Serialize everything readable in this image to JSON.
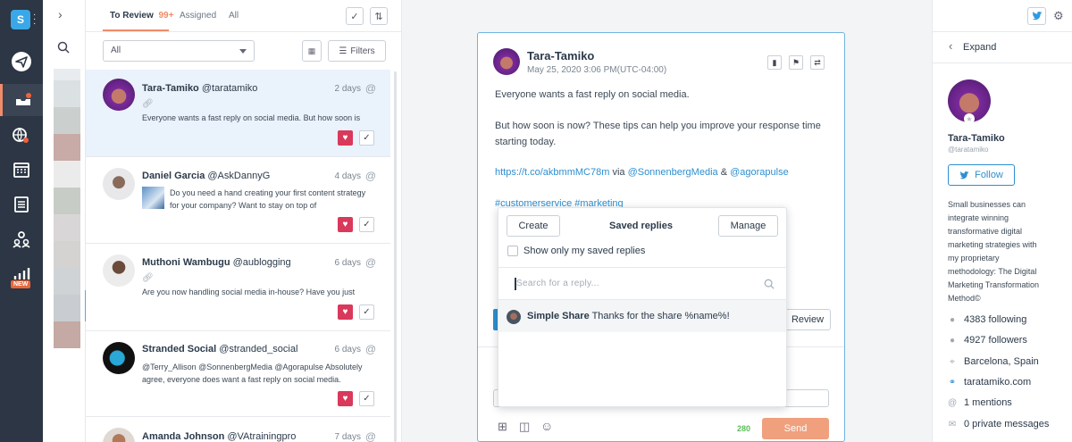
{
  "nav": {
    "brand_letter": "S",
    "items": [
      {
        "name": "publish",
        "icon": "paper-plane-icon"
      },
      {
        "name": "inbox",
        "icon": "inbox-icon",
        "active": true
      },
      {
        "name": "listening",
        "icon": "globe-search-icon"
      },
      {
        "name": "calendar",
        "icon": "calendar-icon"
      },
      {
        "name": "planner",
        "icon": "clipboard-calendar-icon"
      },
      {
        "name": "team",
        "icon": "team-icon"
      },
      {
        "name": "reports",
        "icon": "bar-chart-icon"
      }
    ],
    "new_badge": "NEW",
    "accent_color": "#f08c6a"
  },
  "list": {
    "tabs": {
      "to_review": "To Review",
      "to_review_count": "99+",
      "assigned": "Assigned",
      "all": "All"
    },
    "filter_select": "All",
    "filters_label": "Filters",
    "items": [
      {
        "name": "Tara-Tamiko",
        "handle": "@taratamiko",
        "date": "2 days",
        "body": "Everyone wants a fast reply on social media. But how soon is"
      },
      {
        "name": "Daniel Garcia",
        "handle": "@AskDannyG",
        "date": "4 days",
        "body": "Do you need a hand creating your first content strategy for your company? Want to stay on top of"
      },
      {
        "name": "Muthoni Wambugu",
        "handle": "@aublogging",
        "date": "6 days",
        "body": "Are you now handling social media in-house? Have you just"
      },
      {
        "name": "Stranded Social",
        "handle": "@stranded_social",
        "date": "6 days",
        "body": "@Terry_Allison @SonnenbergMedia @Agorapulse Absolutely agree, everyone does want a fast reply on social media."
      },
      {
        "name": "Amanda Johnson",
        "handle": "@VAtrainingpro",
        "date": "7 days",
        "body": ""
      }
    ]
  },
  "detail": {
    "name": "Tara-Tamiko",
    "date": "May 25, 2020 3:06 PM(UTC-04:00)",
    "p1": "Everyone wants a fast reply on social media.",
    "p2a": "But how soon is now? These tips can help you improve your response time",
    "p2b": "starting today.",
    "link_url": "https://t.co/akbmmMC78m",
    "via": "via",
    "mention1": "@SonnenbergMedia",
    "amp": "&",
    "mention2": "@agorapulse",
    "hashtags": "#customerservice #marketing",
    "review_label": "Review",
    "char_count": "280",
    "send_label": "Send"
  },
  "saved_replies": {
    "create_label": "Create",
    "title": "Saved replies",
    "manage_label": "Manage",
    "only_mine_label": "Show only my saved replies",
    "search_placeholder": "Search for a reply...",
    "items": [
      {
        "title": "Simple Share",
        "text": "Thanks for the share %name%!"
      }
    ]
  },
  "profile": {
    "expand_label": "Expand",
    "name": "Tara-Tamiko",
    "handle": "@taratamiko",
    "follow_label": "Follow",
    "bio": [
      "Small businesses can",
      "integrate winning",
      "transformative digital",
      "marketing strategies with",
      "my proprietary",
      "methodology: The Digital",
      "Marketing Transformation",
      "Method©"
    ],
    "stats": [
      {
        "icon": "user-icon",
        "text": "4383 following"
      },
      {
        "icon": "users-icon",
        "text": "4927 followers"
      },
      {
        "icon": "location-pin-icon",
        "text": "Barcelona, Spain"
      },
      {
        "icon": "link-icon",
        "text": "taratamiko.com",
        "link": true
      },
      {
        "icon": "at-icon",
        "text": "1 mentions"
      },
      {
        "icon": "envelope-icon",
        "text": "0 private messages"
      }
    ]
  },
  "colors": {
    "nav_bg": "#2c3644",
    "link": "#2e8fd0",
    "heart": "#d9395a",
    "send": "#f0a07d",
    "count": "#5bbd5b"
  }
}
